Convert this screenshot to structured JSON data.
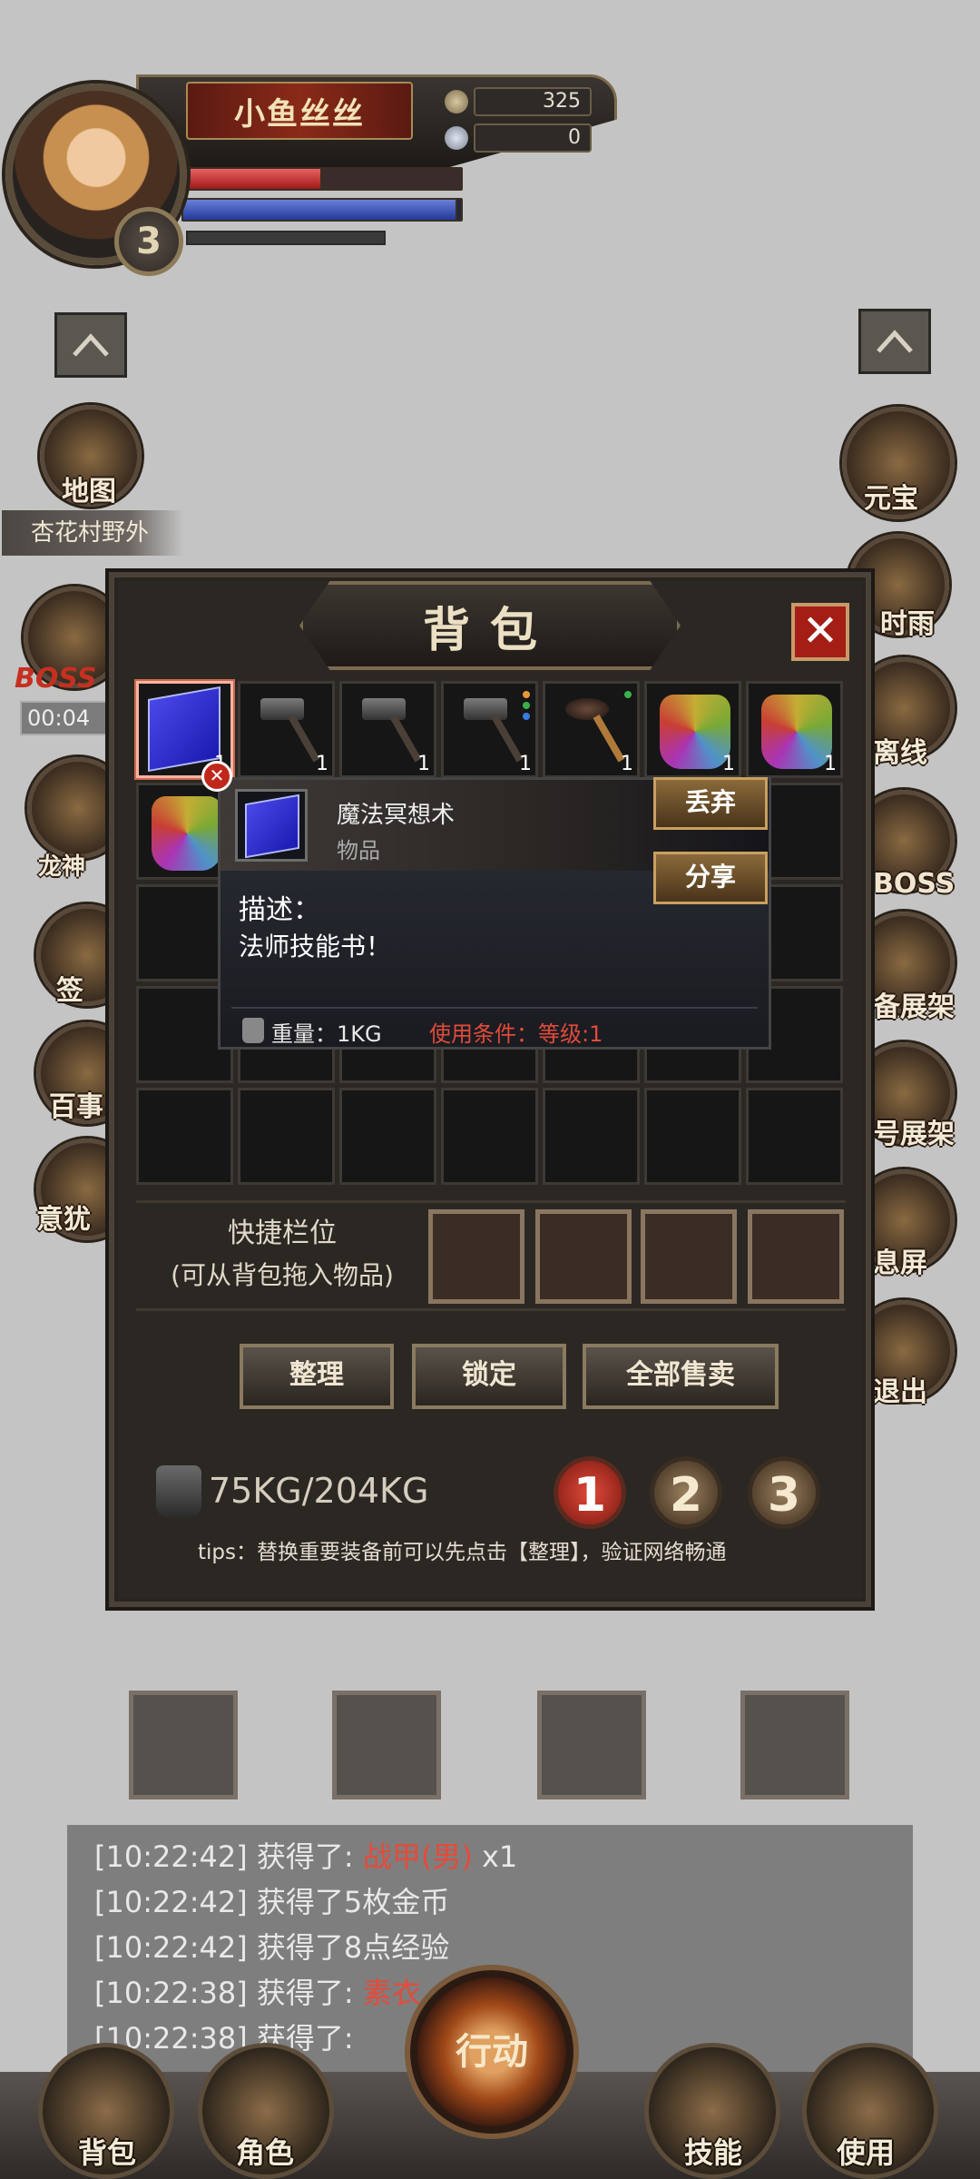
{
  "player": {
    "name": "小鱼丝丝",
    "level": "3",
    "gold": "325",
    "gems": "0",
    "hp_fraction": 0.5,
    "mp_fraction": 0.98
  },
  "left_menu": {
    "map_label": "地图",
    "location": "杏花村野外",
    "boss_label": "BOSS",
    "boss_timer": "00:04",
    "dragon_label": "龙神",
    "sign_label": "签",
    "task_label": "百事",
    "event_label": "意犹"
  },
  "right_menu": {
    "yuanbao": "元宝",
    "shiyu": "时雨",
    "lixian": "离线",
    "boss": "BOSS",
    "equip_show": "备展架",
    "title_show": "号展架",
    "screen": "息屏",
    "exit": "退出"
  },
  "bag": {
    "title": "背包",
    "close_label": "✕",
    "row1_counts": [
      "1",
      "1",
      "1",
      "1",
      "1",
      "1",
      "1"
    ],
    "tooltip": {
      "name": "魔法冥想术",
      "type": "物品",
      "desc_label": "描述：",
      "desc": "法师技能书！",
      "weight": "重量：1KG",
      "requirement": "使用条件：等级:1",
      "discard": "丢弃",
      "share": "分享"
    },
    "quick_label_1": "快捷栏位",
    "quick_label_2": "(可从背包拖入物品)",
    "buttons": {
      "sort": "整理",
      "lock": "锁定",
      "sell_all": "全部售卖"
    },
    "weight": "75KG/204KG",
    "pages": [
      "1",
      "2",
      "3"
    ],
    "tips": "tips：替换重要装备前可以先点击【整理】，验证网络畅通"
  },
  "log": [
    {
      "prefix": "[10:22:42] 获得了: ",
      "highlight": "战甲(男)",
      "suffix": " x1"
    },
    {
      "prefix": "[10:22:42] 获得了5枚金币",
      "highlight": "",
      "suffix": ""
    },
    {
      "prefix": "[10:22:42] 获得了8点经验",
      "highlight": "",
      "suffix": ""
    },
    {
      "prefix": "[10:22:38] 获得了: ",
      "highlight": "素衣",
      "suffix": ""
    },
    {
      "prefix": "[10:22:38] 获得了: ",
      "highlight": "",
      "suffix": ""
    }
  ],
  "bottom_nav": {
    "bag": "背包",
    "role": "角色",
    "action": "行动",
    "skill": "技能",
    "use": "使用"
  },
  "colors": {
    "accent_red": "#e04b3a",
    "panel": "#2b2723",
    "gold_border": "#c9a060"
  }
}
